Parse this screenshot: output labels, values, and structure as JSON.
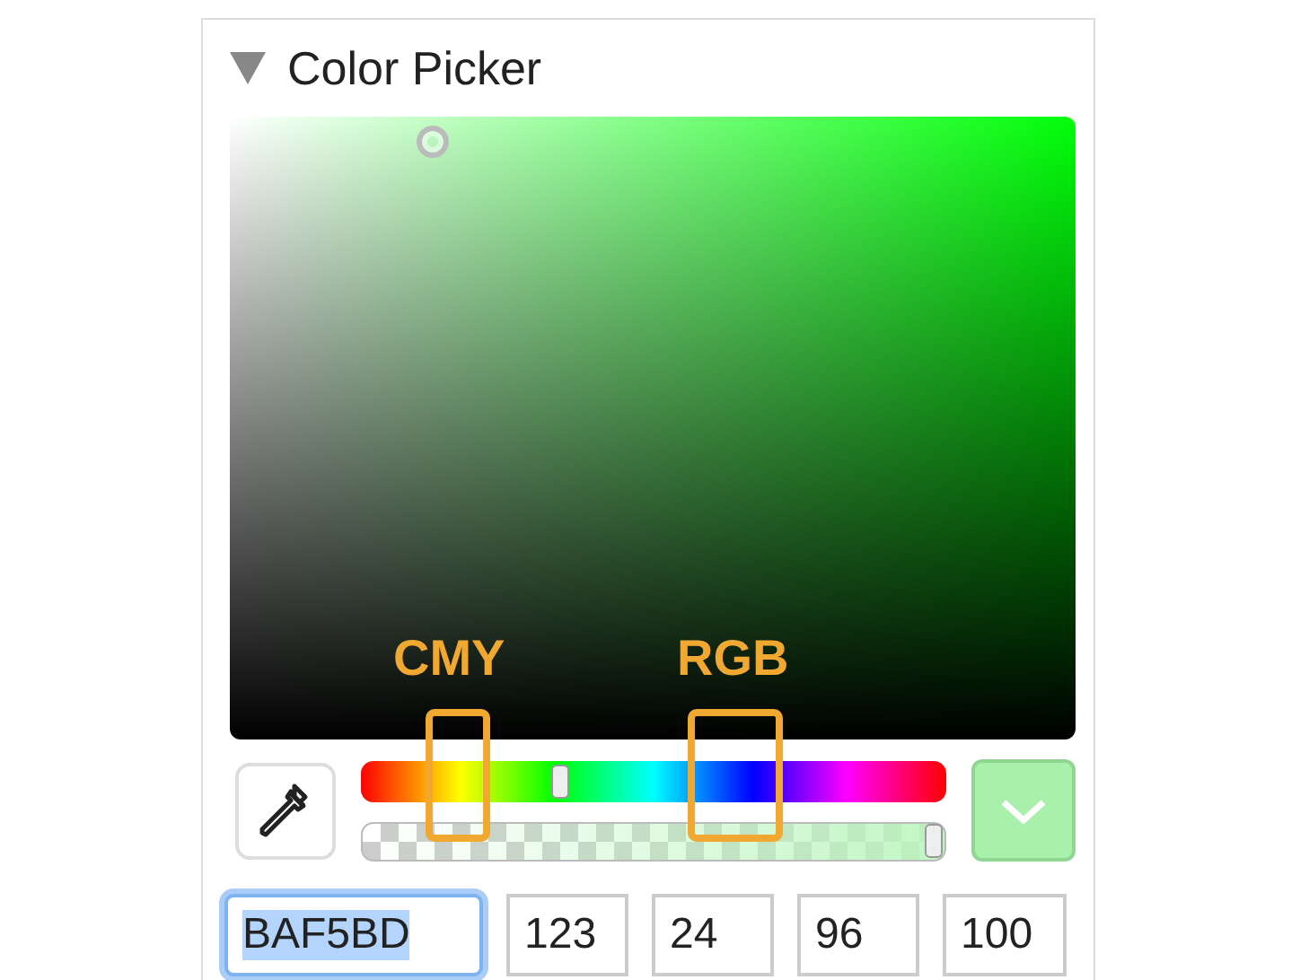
{
  "panel": {
    "title": "Color Picker",
    "expanded": true
  },
  "hue_slider": {
    "level": 0.34
  },
  "alpha_slider": {
    "level": 1
  },
  "annotations": [
    {
      "label": "CMY"
    },
    {
      "label": "RGB"
    }
  ],
  "fields": [
    {
      "kind": "hex",
      "value": "BAF5BD",
      "focused": true
    },
    {
      "kind": "number",
      "value": "123",
      "focused": false
    },
    {
      "kind": "number",
      "value": "24",
      "focused": false
    },
    {
      "kind": "number",
      "value": "96",
      "focused": false
    },
    {
      "kind": "number",
      "value": "100",
      "focused": false
    }
  ]
}
